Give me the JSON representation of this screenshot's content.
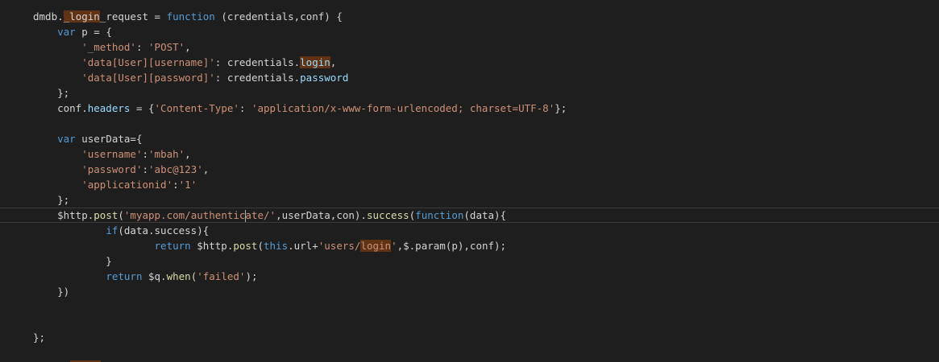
{
  "editor": {
    "lines": [
      [
        [
          "tok-plain",
          "dmdb."
        ],
        [
          "tok-hl-plain",
          "_login"
        ],
        [
          "tok-plain",
          "_request = "
        ],
        [
          "tok-kw",
          "function"
        ],
        [
          "tok-plain",
          " (credentials,conf) {"
        ]
      ],
      [
        [
          "tok-plain",
          "    "
        ],
        [
          "tok-kw",
          "var"
        ],
        [
          "tok-plain",
          " p = {"
        ]
      ],
      [
        [
          "tok-plain",
          "        "
        ],
        [
          "tok-str",
          "'_method'"
        ],
        [
          "tok-plain",
          ": "
        ],
        [
          "tok-str",
          "'POST'"
        ],
        [
          "tok-plain",
          ","
        ]
      ],
      [
        [
          "tok-plain",
          "        "
        ],
        [
          "tok-str",
          "'data[User][username]'"
        ],
        [
          "tok-plain",
          ": credentials."
        ],
        [
          "tok-hl-id",
          "login"
        ],
        [
          "tok-plain",
          ","
        ]
      ],
      [
        [
          "tok-plain",
          "        "
        ],
        [
          "tok-str",
          "'data[User][password]'"
        ],
        [
          "tok-plain",
          ": credentials."
        ],
        [
          "tok-id",
          "password"
        ]
      ],
      [
        [
          "tok-plain",
          "    };"
        ]
      ],
      [
        [
          "tok-plain",
          "    conf."
        ],
        [
          "tok-id",
          "headers"
        ],
        [
          "tok-plain",
          " = {"
        ],
        [
          "tok-str",
          "'Content-Type'"
        ],
        [
          "tok-plain",
          ": "
        ],
        [
          "tok-str",
          "'application/x-www-form-urlencoded; charset=UTF-8'"
        ],
        [
          "tok-plain",
          "};"
        ]
      ],
      [],
      [
        [
          "tok-plain",
          "    "
        ],
        [
          "tok-kw",
          "var"
        ],
        [
          "tok-plain",
          " userData={"
        ]
      ],
      [
        [
          "tok-plain",
          "        "
        ],
        [
          "tok-str",
          "'username'"
        ],
        [
          "tok-plain",
          ":"
        ],
        [
          "tok-str",
          "'mbah'"
        ],
        [
          "tok-plain",
          ","
        ]
      ],
      [
        [
          "tok-plain",
          "        "
        ],
        [
          "tok-str",
          "'password'"
        ],
        [
          "tok-plain",
          ":"
        ],
        [
          "tok-str",
          "'abc@123'"
        ],
        [
          "tok-plain",
          ","
        ]
      ],
      [
        [
          "tok-plain",
          "        "
        ],
        [
          "tok-str",
          "'applicationid'"
        ],
        [
          "tok-plain",
          ":"
        ],
        [
          "tok-str",
          "'1'"
        ]
      ],
      [
        [
          "tok-plain",
          "    };"
        ]
      ],
      [
        [
          "tok-plain",
          "    $http."
        ],
        [
          "tok-fn",
          "post"
        ],
        [
          "tok-plain",
          "("
        ],
        [
          "tok-str",
          "'myapp.com/authentic"
        ],
        [
          "caret",
          ""
        ],
        [
          "tok-str",
          "ate/'"
        ],
        [
          "tok-plain",
          ",userData,con)."
        ],
        [
          "tok-fn",
          "success"
        ],
        [
          "tok-plain",
          "("
        ],
        [
          "tok-kw",
          "function"
        ],
        [
          "tok-plain",
          "(data){"
        ]
      ],
      [
        [
          "tok-plain",
          "            "
        ],
        [
          "tok-kw",
          "if"
        ],
        [
          "tok-plain",
          "(data.success){"
        ]
      ],
      [
        [
          "tok-plain",
          "                    "
        ],
        [
          "tok-kw",
          "return"
        ],
        [
          "tok-plain",
          " $http."
        ],
        [
          "tok-fn",
          "post"
        ],
        [
          "tok-plain",
          "("
        ],
        [
          "tok-kw",
          "this"
        ],
        [
          "tok-plain",
          ".url+"
        ],
        [
          "tok-str",
          "'users/"
        ],
        [
          "tok-hl-str",
          "login"
        ],
        [
          "tok-str",
          "'"
        ],
        [
          "tok-plain",
          ",$.param(p),conf);"
        ]
      ],
      [
        [
          "tok-plain",
          "            }"
        ]
      ],
      [
        [
          "tok-plain",
          "            "
        ],
        [
          "tok-kw",
          "return"
        ],
        [
          "tok-plain",
          " $q."
        ],
        [
          "tok-fn",
          "when"
        ],
        [
          "tok-plain",
          "("
        ],
        [
          "tok-str",
          "'failed'"
        ],
        [
          "tok-plain",
          ");"
        ]
      ],
      [
        [
          "tok-plain",
          "    })"
        ]
      ],
      [],
      [],
      [
        [
          "tok-plain",
          "};"
        ]
      ]
    ],
    "current_line_index": 13
  }
}
